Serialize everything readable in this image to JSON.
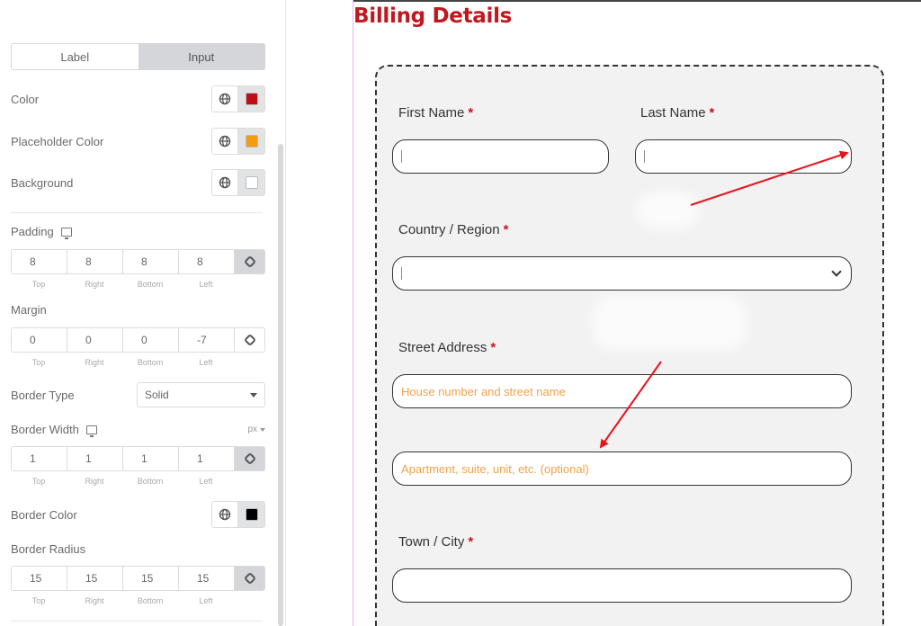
{
  "panel": {
    "tabs": [
      {
        "label": "Label",
        "active": false
      },
      {
        "label": "Input",
        "active": true
      }
    ],
    "color_rows": [
      {
        "label": "Color",
        "swatch": "#c00c12",
        "icon": "globe-icon"
      },
      {
        "label": "Placeholder Color",
        "swatch": "#f39c12",
        "icon": "globe-icon"
      },
      {
        "label": "Background",
        "swatch": "#ffffff",
        "icon": "globe-icon"
      }
    ],
    "padding": {
      "label": "Padding",
      "values": [
        "8",
        "8",
        "8",
        "8"
      ],
      "sides": [
        "Top",
        "Right",
        "Bottom",
        "Left"
      ]
    },
    "margin": {
      "label": "Margin",
      "values": [
        "0",
        "0",
        "0",
        "-7"
      ],
      "sides": [
        "Top",
        "Right",
        "Bottom",
        "Left"
      ]
    },
    "border_type": {
      "label": "Border Type",
      "value": "Solid"
    },
    "border_width": {
      "label": "Border Width",
      "unit": "px",
      "values": [
        "1",
        "1",
        "1",
        "1"
      ],
      "sides": [
        "Top",
        "Right",
        "Bottom",
        "Left"
      ]
    },
    "border_color": {
      "label": "Border Color",
      "swatch": "#000000"
    },
    "border_radius": {
      "label": "Border Radius",
      "values": [
        "15",
        "15",
        "15",
        "15"
      ],
      "sides": [
        "Top",
        "Right",
        "Bottom",
        "Left"
      ]
    }
  },
  "form": {
    "title": "Billing Details",
    "required_mark": "*",
    "first_name": {
      "label": "First Name"
    },
    "last_name": {
      "label": "Last Name"
    },
    "country": {
      "label": "Country / Region"
    },
    "street": {
      "label": "Street Address",
      "placeholder1": "House number and street name",
      "placeholder2": "Apartment, suite, unit, etc. (optional)"
    },
    "town": {
      "label": "Town / City"
    }
  },
  "colors": {
    "accent_red": "#c0181f",
    "required_red": "#d0121b",
    "placeholder_orange": "#f0a24b",
    "arrow_red": "#e8141c"
  }
}
